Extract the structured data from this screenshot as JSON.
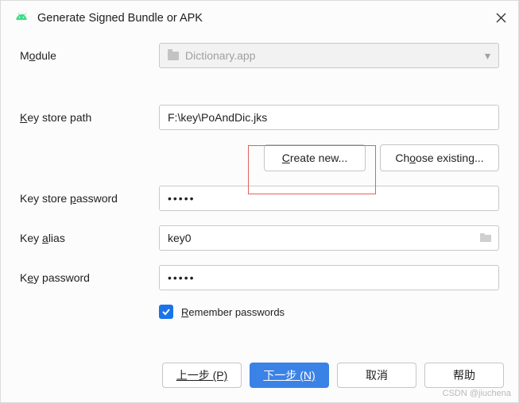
{
  "window": {
    "title": "Generate Signed Bundle or APK"
  },
  "module": {
    "label_pre": "M",
    "label_ul": "o",
    "label_post": "dule",
    "value": "Dictionary.app"
  },
  "keystore_path": {
    "label_ul": "K",
    "label_post": "ey store path",
    "value": "F:\\key\\PoAndDic.jks"
  },
  "buttons": {
    "create_new_ul": "C",
    "create_new_post": "reate new...",
    "choose_existing_pre": "Ch",
    "choose_existing_ul": "o",
    "choose_existing_post": "ose existing..."
  },
  "keystore_password": {
    "label_pre": "Key store ",
    "label_ul": "p",
    "label_post": "assword",
    "value": "•••••"
  },
  "key_alias": {
    "label_pre": "Key ",
    "label_ul": "a",
    "label_post": "lias",
    "value": "key0"
  },
  "key_password": {
    "label_pre": "K",
    "label_ul": "e",
    "label_post": "y password",
    "value": "•••••"
  },
  "remember": {
    "label_ul": "R",
    "label_post": "emember passwords"
  },
  "footer": {
    "prev": "上一步 (P)",
    "next": "下一步 (N)",
    "cancel": "取消",
    "help": "帮助"
  },
  "watermark": "CSDN @jiuchena"
}
